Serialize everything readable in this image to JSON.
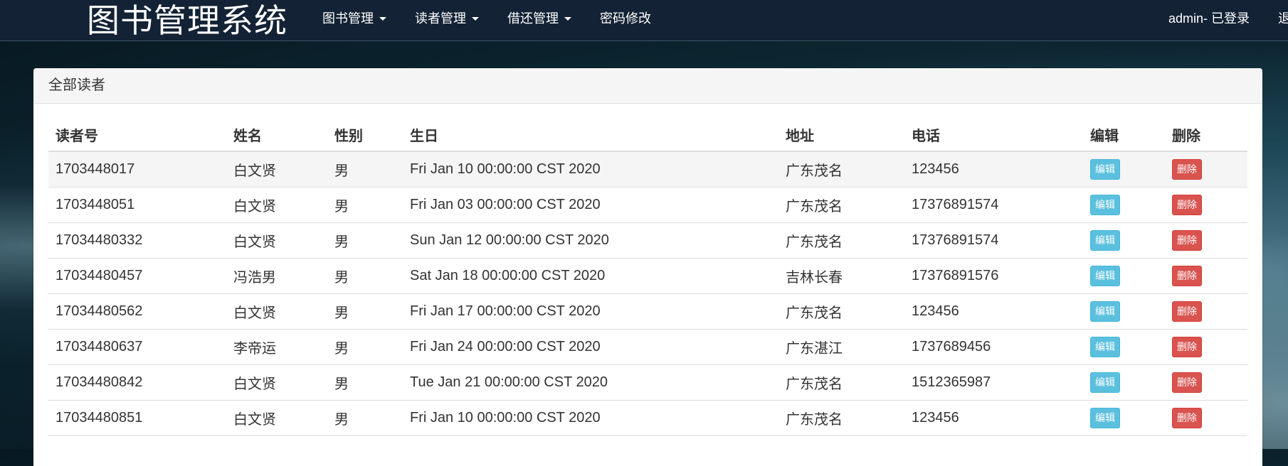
{
  "navbar": {
    "brand": "图书管理系统",
    "menu": [
      {
        "label": "图书管理",
        "dropdown": true
      },
      {
        "label": "读者管理",
        "dropdown": true
      },
      {
        "label": "借还管理",
        "dropdown": true
      },
      {
        "label": "密码修改",
        "dropdown": false
      }
    ],
    "login_status": "admin- 已登录",
    "logout_label": "退出"
  },
  "panel": {
    "title": "全部读者"
  },
  "table": {
    "columns": [
      "读者号",
      "姓名",
      "性别",
      "生日",
      "地址",
      "电话",
      "编辑",
      "删除"
    ],
    "edit_label": "编辑",
    "delete_label": "删除",
    "rows": [
      {
        "id": "1703448017",
        "name": "白文贤",
        "gender": "男",
        "birthday": "Fri Jan 10 00:00:00 CST 2020",
        "address": "广东茂名",
        "phone": "123456"
      },
      {
        "id": "1703448051",
        "name": "白文贤",
        "gender": "男",
        "birthday": "Fri Jan 03 00:00:00 CST 2020",
        "address": "广东茂名",
        "phone": "17376891574"
      },
      {
        "id": "17034480332",
        "name": "白文贤",
        "gender": "男",
        "birthday": "Sun Jan 12 00:00:00 CST 2020",
        "address": "广东茂名",
        "phone": "17376891574"
      },
      {
        "id": "17034480457",
        "name": "冯浩男",
        "gender": "男",
        "birthday": "Sat Jan 18 00:00:00 CST 2020",
        "address": "吉林长春",
        "phone": "17376891576"
      },
      {
        "id": "17034480562",
        "name": "白文贤",
        "gender": "男",
        "birthday": "Fri Jan 17 00:00:00 CST 2020",
        "address": "广东茂名",
        "phone": "123456"
      },
      {
        "id": "17034480637",
        "name": "李帝运",
        "gender": "男",
        "birthday": "Fri Jan 24 00:00:00 CST 2020",
        "address": "广东湛江",
        "phone": "1737689456"
      },
      {
        "id": "17034480842",
        "name": "白文贤",
        "gender": "男",
        "birthday": "Tue Jan 21 00:00:00 CST 2020",
        "address": "广东茂名",
        "phone": "1512365987"
      },
      {
        "id": "17034480851",
        "name": "白文贤",
        "gender": "男",
        "birthday": "Fri Jan 10 00:00:00 CST 2020",
        "address": "广东茂名",
        "phone": "123456"
      }
    ]
  },
  "colors": {
    "navbar_bg": "#132235",
    "edit_button": "#5bc0de",
    "delete_button": "#d9534f",
    "row_stripe": "#f5f5f5"
  }
}
